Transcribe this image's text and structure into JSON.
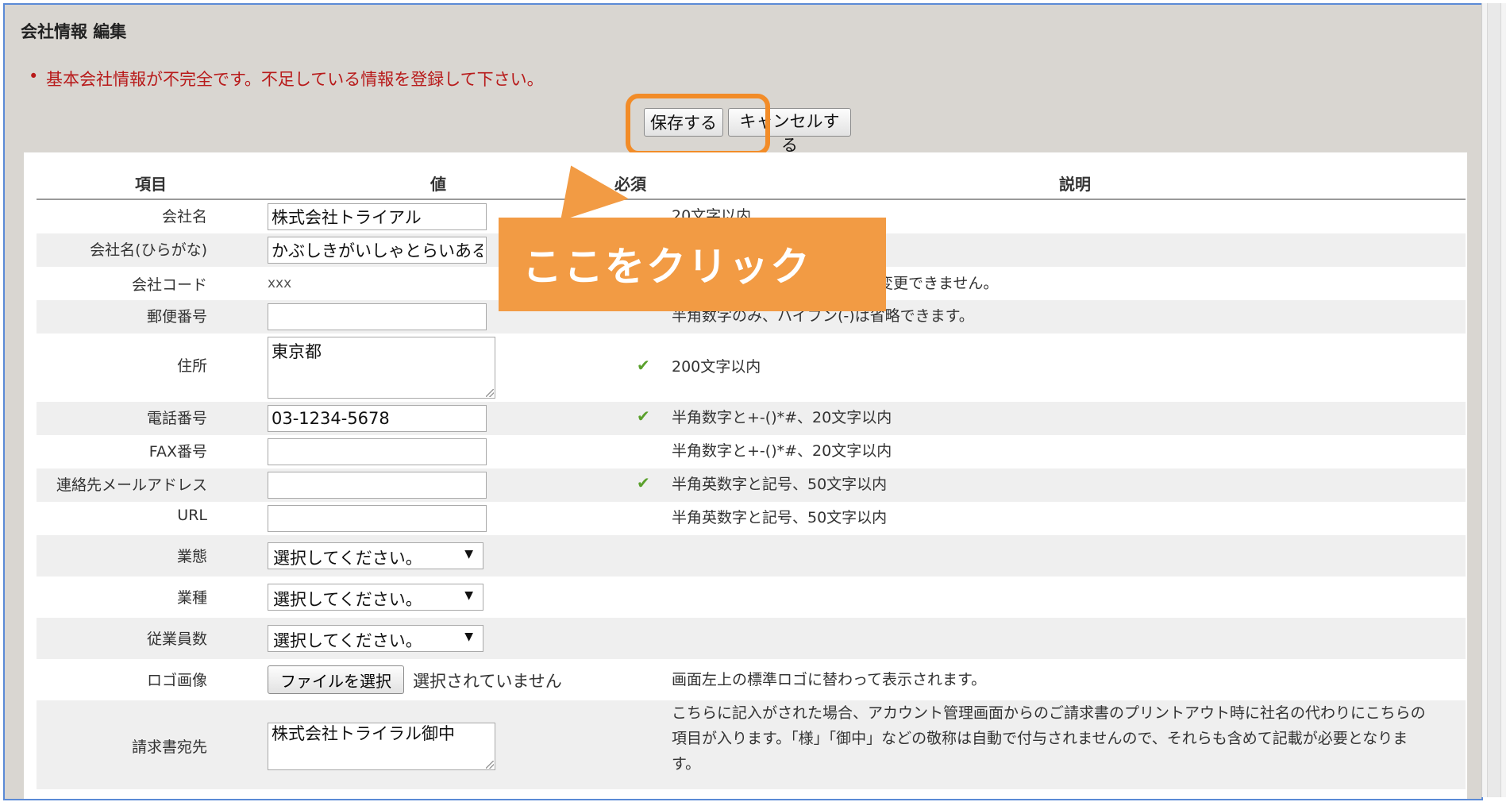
{
  "page": {
    "title": "会社情報 編集"
  },
  "error": {
    "bullet": "•",
    "message": "基本会社情報が不完全です。不足している情報を登録して下さい。"
  },
  "actions": {
    "save": "保存する",
    "cancel": "キャンセルする"
  },
  "headers": {
    "item": "項目",
    "value": "値",
    "required": "必須",
    "description": "説明"
  },
  "rows": [
    {
      "label": "会社名",
      "value": "株式会社トライアル",
      "required": false,
      "description": "20文字以内"
    },
    {
      "label": "会社名(ひらがな)",
      "value": "かぶしきがいしゃとらいある",
      "required": false,
      "description": ""
    },
    {
      "label": "会社コード",
      "value": "xxx",
      "required": false,
      "description": "変更できません。"
    },
    {
      "label": "郵便番号",
      "value": "",
      "required": false,
      "description": "半角数字のみ、ハイフン(-)は省略できます。"
    },
    {
      "label": "住所",
      "value": "東京都",
      "required": true,
      "description": "200文字以内"
    },
    {
      "label": "電話番号",
      "value": "03-1234-5678",
      "required": true,
      "description": "半角数字と+-()*#、20文字以内"
    },
    {
      "label": "FAX番号",
      "value": "",
      "required": false,
      "description": "半角数字と+-()*#、20文字以内"
    },
    {
      "label": "連絡先メールアドレス",
      "value": "",
      "required": true,
      "description": "半角英数字と記号、50文字以内"
    },
    {
      "label": "URL",
      "value": "",
      "required": false,
      "description": "半角英数字と記号、50文字以内"
    },
    {
      "label": "業態",
      "value": "選択してください。",
      "required": false,
      "description": ""
    },
    {
      "label": "業種",
      "value": "選択してください。",
      "required": false,
      "description": ""
    },
    {
      "label": "従業員数",
      "value": "選択してください。",
      "required": false,
      "description": ""
    },
    {
      "label": "ロゴ画像",
      "button": "ファイルを選択",
      "status": "選択されていません",
      "description": "画面左上の標準ロゴに替わって表示されます。"
    },
    {
      "label": "請求書宛先",
      "value": "株式会社トライラル御中",
      "description_lines": [
        "こちらに記入がされた場合、アカウント管理画面からのご請求書のプリントアウト時に社名の代わりにこちらの",
        "項目が入ります。「様」「御中」などの敬称は自動で付与されませんので、それらも含めて記載が必要となりま",
        "す。"
      ]
    }
  ],
  "check_mark": "✔",
  "select_arrow": "▼",
  "callout": {
    "text": "ここをクリック",
    "color": "#f29b44"
  },
  "colors": {
    "error": "#b81a1a",
    "highlight": "#f28c28",
    "check": "#5aa02c",
    "frame": "#5b8ad6"
  }
}
